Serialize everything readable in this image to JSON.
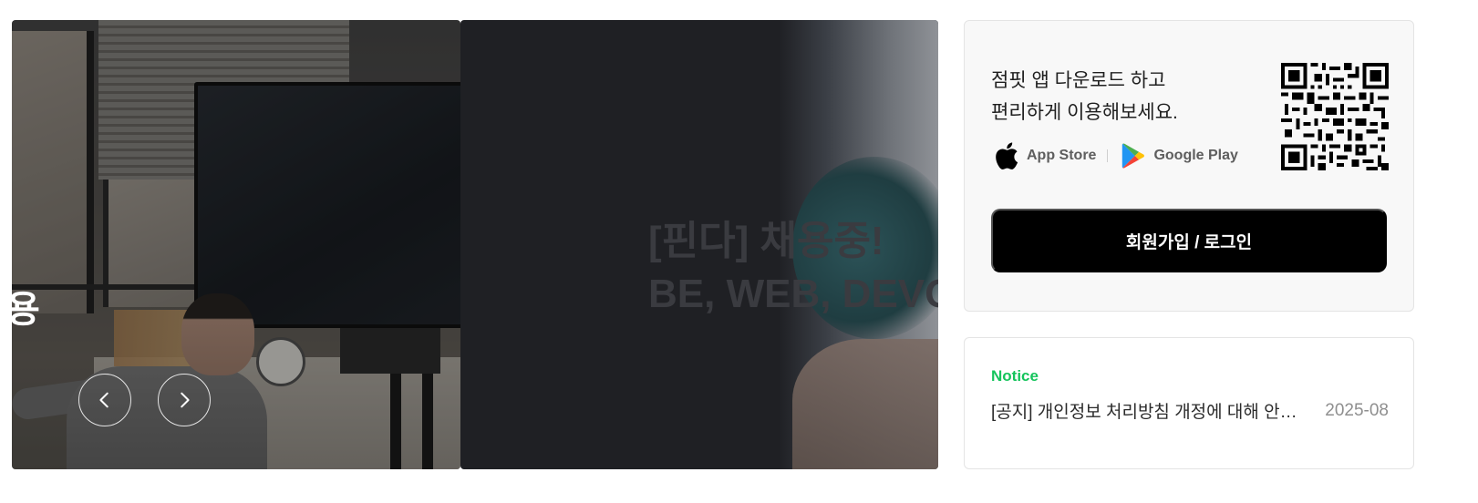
{
  "carousel": {
    "slides": [
      {
        "kind": "office-photo",
        "edge_text": "용"
      },
      {
        "kind": "hiring",
        "title_line1": "[핀다] 채용중!",
        "title_line2": "BE, WEB, DEVO"
      }
    ],
    "controls": {
      "prev_icon": "chevron-left-icon",
      "next_icon": "chevron-right-icon"
    }
  },
  "app_download": {
    "text_line1": "점핏 앱 다운로드 하고",
    "text_line2": "편리하게 이용해보세요.",
    "app_store_label": "App Store",
    "google_play_label": "Google Play",
    "qr_icon": "qr-code-icon",
    "signup_label": "회원가입 / 로그인"
  },
  "notice": {
    "label": "Notice",
    "title": "[공지] 개인정보 처리방침 개정에 대해 안내드립니다.",
    "date": "2025-08"
  },
  "colors": {
    "notice_accent": "#15c45c",
    "signup_bg": "#000000",
    "card_bg": "#f8f8f8"
  }
}
